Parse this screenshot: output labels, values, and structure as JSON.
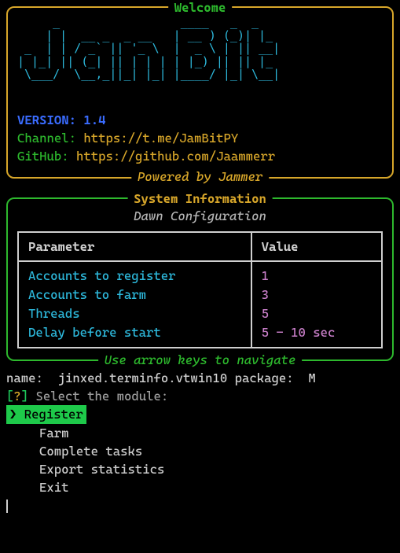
{
  "welcome": {
    "title": "Welcome",
    "subtitle": "Powered by Jammer",
    "ascii": "     _                 ____   _  _   \n    | |  __ _  _ __   | __ ) (_)| |_ \n _  | | / _` || '_ \\  |  _ \\ | || __|\n| |_| || (_| || | | | | |_) || || |_ \n \\___/  \\__,_||_| |_| |____/ |_| \\__|\n                                     ",
    "version_label": "VERSION:",
    "version_value": "1.4",
    "channel_label": "Channel:",
    "channel_value": "https://t.me/JamBitPY",
    "github_label": "GitHub:",
    "github_value": "https://github.com/Jaammerr"
  },
  "system": {
    "title": "System Information",
    "subtitle": "Dawn Configuration",
    "nav_hint": "Use arrow keys to navigate",
    "columns": {
      "param": "Parameter",
      "value": "Value"
    },
    "rows": [
      {
        "param": "Accounts to register",
        "value": "1"
      },
      {
        "param": "Accounts to farm",
        "value": "3"
      },
      {
        "param": "Threads",
        "value": "5"
      },
      {
        "param": "Delay before start",
        "value": "5 - 10 sec"
      }
    ]
  },
  "terminal": {
    "info_line": "name:  jinxed.terminfo.vtwin10 package:  M",
    "prompt_open": "[",
    "prompt_q": "?",
    "prompt_close": "]",
    "prompt_text": " Select the module:",
    "pointer": "❯ ",
    "menu": [
      {
        "label": "Register",
        "selected": true
      },
      {
        "label": "Farm",
        "selected": false
      },
      {
        "label": "Complete tasks",
        "selected": false
      },
      {
        "label": "Export statistics",
        "selected": false
      },
      {
        "label": "Exit",
        "selected": false
      }
    ]
  }
}
